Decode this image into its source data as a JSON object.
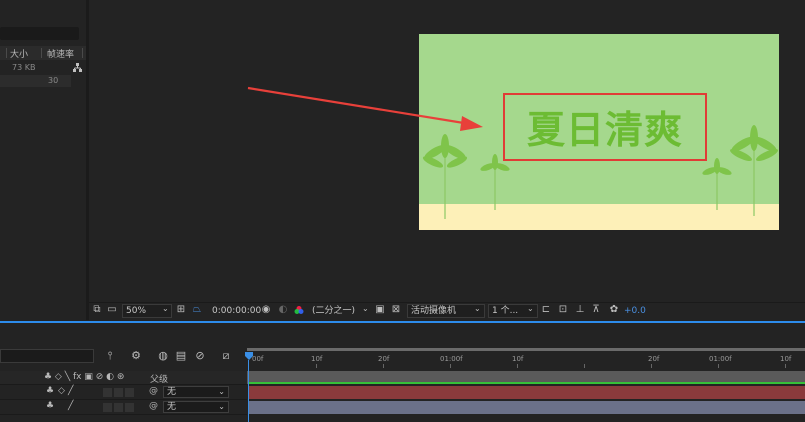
{
  "project_panel": {
    "columns": [
      "大小",
      "帧速率"
    ],
    "rows": [
      {
        "size": "73 KB",
        "framerate": ""
      },
      {
        "size": "",
        "framerate": "30"
      }
    ],
    "flowchart_icon": "flowchart-icon"
  },
  "composition": {
    "title": "夏日清爽",
    "colors": {
      "grass": "#a5d88d",
      "sand": "#fdf0b8",
      "title": "#6cbc33",
      "highlight_box": "#e03c36",
      "arrow": "#e8403a"
    }
  },
  "viewer_toolbar": {
    "zoom": "50%",
    "timecode": "0:00:00:00",
    "resolution": "(二分之一)",
    "camera": "活动摄像机",
    "views": "1 个...",
    "exposure": "+0.0"
  },
  "timeline": {
    "ruler_labels": [
      "00f",
      "10f",
      "20f",
      "01:00f",
      "10f",
      "20f",
      "01:00f",
      "10f"
    ],
    "parent_column": "父级",
    "layers": [
      {
        "parent": "无",
        "color": "#8a3a3c"
      },
      {
        "parent": "无",
        "color": "#6b7189"
      }
    ],
    "accent": "#2d8ceb",
    "work_bar_color": "#36c038"
  }
}
